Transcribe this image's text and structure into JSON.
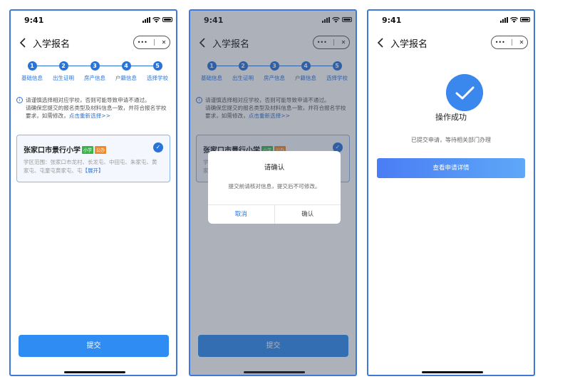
{
  "status_bar": {
    "time": "9:41"
  },
  "nav": {
    "title": "入学报名",
    "back_icon": "chevron-left-icon",
    "more_label": "•••",
    "close_label": "✕"
  },
  "steps": [
    {
      "num": "1",
      "label": "基础信息"
    },
    {
      "num": "2",
      "label": "出生证明"
    },
    {
      "num": "3",
      "label": "房产信息"
    },
    {
      "num": "4",
      "label": "户籍信息"
    },
    {
      "num": "5",
      "label": "选择学校"
    }
  ],
  "notice": {
    "line1": "请谨慎选择相对应学校，否则可能导致申请不通过。",
    "line2": "请确保您提交的报名类型及材料信息一致，并符合报名学校要求，如需修改，",
    "link": "点击重新选择>>"
  },
  "school": {
    "name": "张家口市景行小学",
    "tag1": "小学",
    "tag2": "公办",
    "scope": "学区范围：张家口市龙村、长龙屯、中田屯、朱家屯、黄家屯、屯童屯黄家屯、屯",
    "expand": "【展开】"
  },
  "submit_label": "提交",
  "dialog": {
    "title": "请确认",
    "message": "提交前请核对信息，提交后不可修改。",
    "cancel": "取消",
    "confirm": "确认"
  },
  "success": {
    "title": "操作成功",
    "message": "已提交申请，等待相关部门办理",
    "button": "查看申请详情"
  },
  "colors": {
    "accent": "#2a73d9",
    "button": "#2e8cf2",
    "success": "#3a87ee",
    "tag_green": "#3ab44a",
    "tag_orange": "#f08a2c"
  }
}
